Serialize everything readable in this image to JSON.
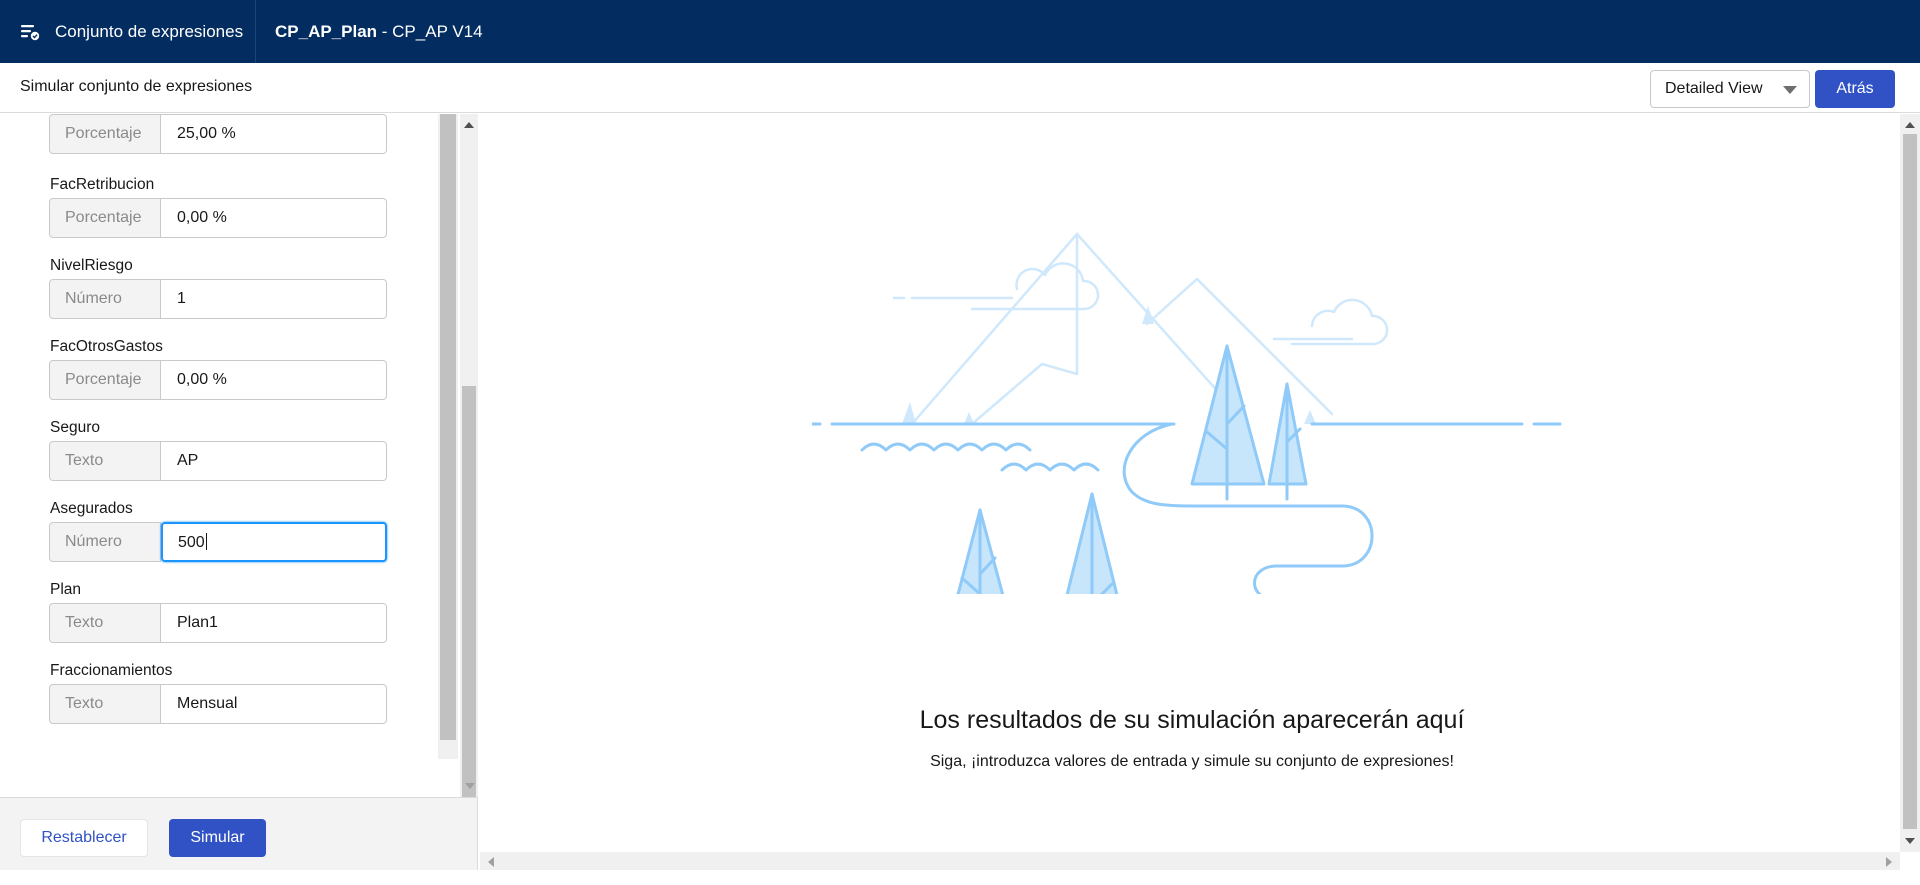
{
  "header": {
    "app_icon": "expression-set-icon",
    "app_title": "Conjunto de expresiones",
    "record_name": "CP_AP_Plan",
    "record_suffix": " - CP_AP V14"
  },
  "subheader": {
    "title": "Simular conjunto de expresiones",
    "view_select": "Detailed View",
    "back_button": "Atrás"
  },
  "fields": [
    {
      "label": "",
      "type": "Porcentaje",
      "value": "25,00 %"
    },
    {
      "label": "FacRetribucion",
      "type": "Porcentaje",
      "value": "0,00 %"
    },
    {
      "label": "NivelRiesgo",
      "type": "Número",
      "value": "1"
    },
    {
      "label": "FacOtrosGastos",
      "type": "Porcentaje",
      "value": "0,00 %"
    },
    {
      "label": "Seguro",
      "type": "Texto",
      "value": "AP"
    },
    {
      "label": "Asegurados",
      "type": "Número",
      "value": "500"
    },
    {
      "label": "Plan",
      "type": "Texto",
      "value": "Plan1"
    },
    {
      "label": "Fraccionamientos",
      "type": "Texto",
      "value": "Mensual"
    }
  ],
  "footer": {
    "reset_button": "Restablecer",
    "simulate_button": "Simular"
  },
  "results": {
    "illustration": "mountains-lake-trees-illustration",
    "title": "Los resultados de su simulación aparecerán aquí",
    "message": "Siga, ¡introduzca valores de entrada y simule su conjunto de expresiones!"
  },
  "colors": {
    "header_bg": "#032d60",
    "brand_button": "#3152c4",
    "focus_border": "#1b96ff",
    "illustration_stroke": "#8fcaf8",
    "illustration_fill": "#c7e5fb"
  }
}
